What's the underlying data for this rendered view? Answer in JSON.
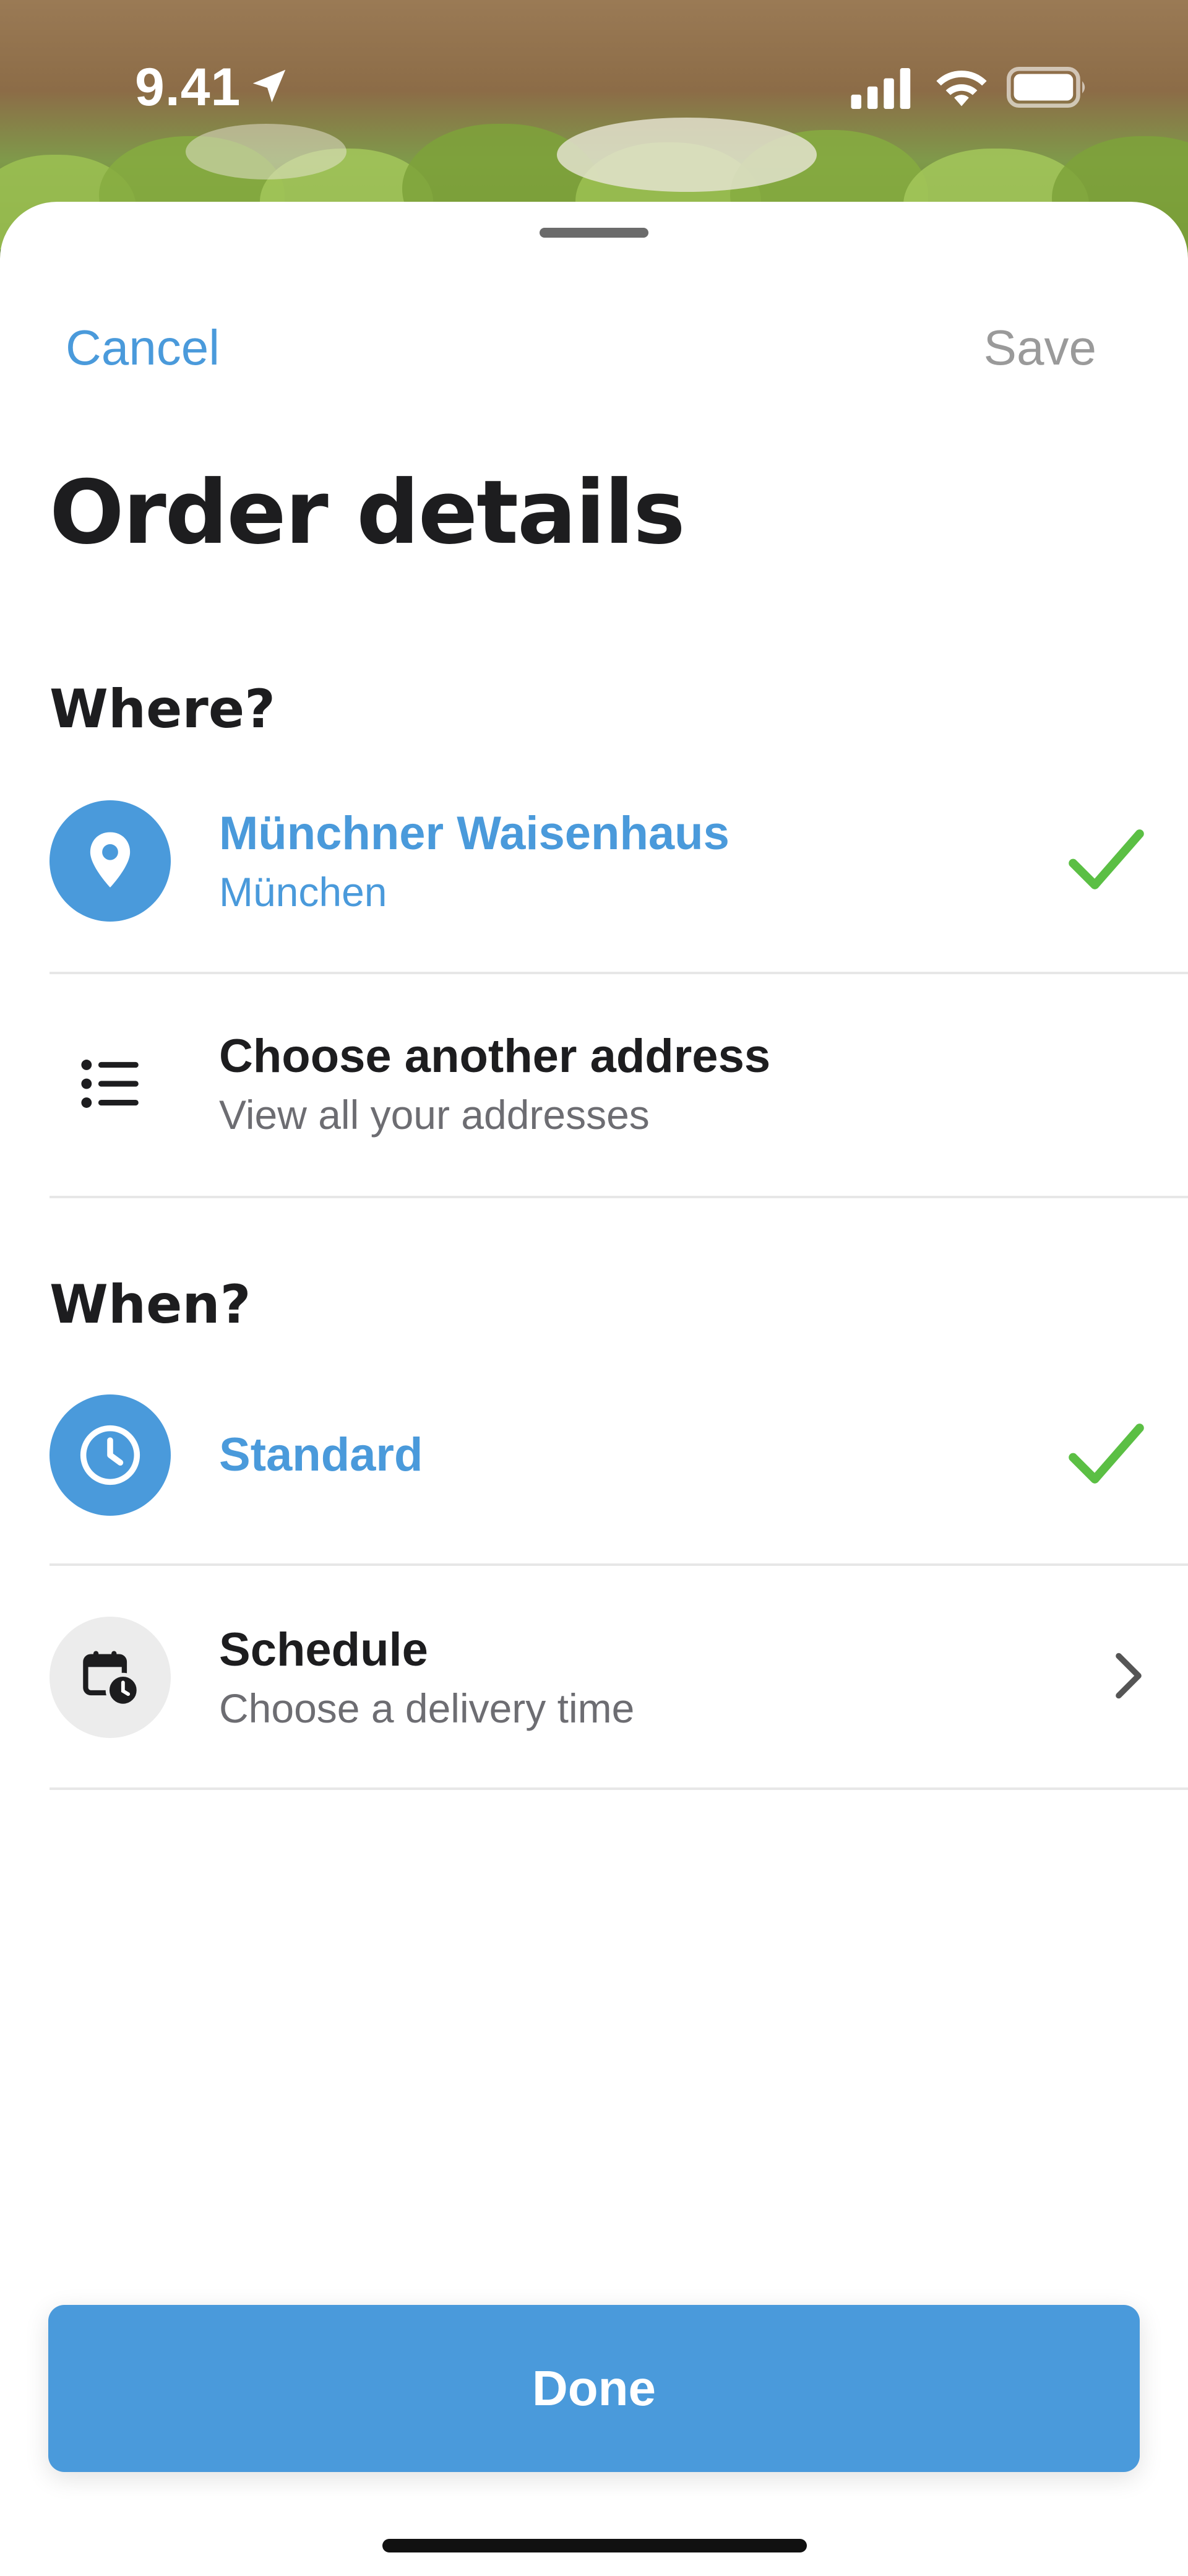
{
  "status_bar": {
    "time": "9.41",
    "icons": [
      "location-arrow-icon",
      "signal-icon",
      "wifi-icon",
      "battery-icon"
    ]
  },
  "nav": {
    "cancel_label": "Cancel",
    "save_label": "Save"
  },
  "title": "Order details",
  "where": {
    "heading": "Where?",
    "selected": {
      "title": "Münchner Waisenhaus",
      "subtitle": "München",
      "icon": "location-pin-icon",
      "status_icon": "checkmark-icon"
    },
    "other": {
      "title": "Choose another address",
      "subtitle": "View all your addresses",
      "icon": "list-icon"
    }
  },
  "when": {
    "heading": "When?",
    "selected": {
      "title": "Standard",
      "icon": "clock-icon",
      "status_icon": "checkmark-icon"
    },
    "schedule": {
      "title": "Schedule",
      "subtitle": "Choose a delivery time",
      "icon": "calendar-clock-icon",
      "chevron": "chevron-right-icon"
    }
  },
  "done_label": "Done",
  "colors": {
    "accent": "#4a9adb",
    "check": "#5bbf44",
    "text": "#1d1d1f",
    "secondary": "#6d6d72",
    "disabled": "#9a9a9a"
  }
}
